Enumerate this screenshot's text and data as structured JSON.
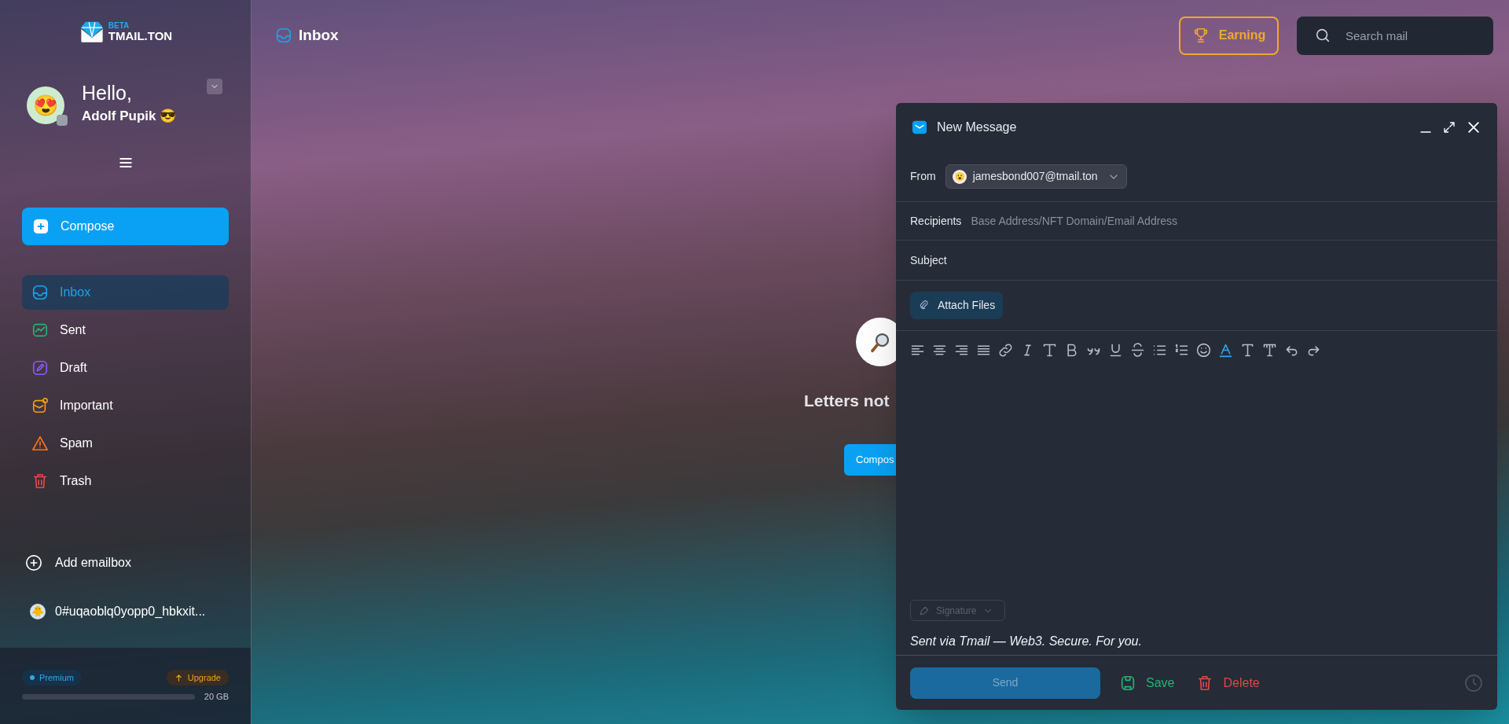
{
  "logo": {
    "badge": "BETA",
    "name": "TMAIL.TON"
  },
  "user": {
    "greeting": "Hello,",
    "name": "Adolf Pupik",
    "name_emoji": "😎",
    "avatar_emoji": "😍"
  },
  "compose_button": "Compose",
  "nav": [
    {
      "label": "Inbox",
      "kind": "inbox",
      "color": "#1aa3f0",
      "selected": true
    },
    {
      "label": "Sent",
      "kind": "sent",
      "color": "#22b573",
      "selected": false
    },
    {
      "label": "Draft",
      "kind": "draft",
      "color": "#8b5cf6",
      "selected": false
    },
    {
      "label": "Important",
      "kind": "important",
      "color": "#f59e0b",
      "selected": false
    },
    {
      "label": "Spam",
      "kind": "spam",
      "color": "#f97316",
      "selected": false
    },
    {
      "label": "Trash",
      "kind": "trash",
      "color": "#ef4444",
      "selected": false
    }
  ],
  "add_emailbox": "Add emailbox",
  "accounts": [
    {
      "emoji": "🐥",
      "address": "0#uqaoblq0yopp0_hbkxit..."
    }
  ],
  "plan": {
    "badge": "Premium",
    "upgrade": "Upgrade",
    "level": 0,
    "storage": "20 GB"
  },
  "header": {
    "title": "Inbox",
    "earning": "Earning",
    "search": {
      "placeholder": "Search mail"
    }
  },
  "empty_state": {
    "message": "Letters not",
    "button": "Compos"
  },
  "compose_window": {
    "title": "New Message",
    "from": {
      "label": "From",
      "emoji": "😮",
      "value": "jamesbond007@tmail.ton"
    },
    "recipients": {
      "label": "Recipients",
      "placeholder": "Base Address/NFT Domain/Email Address"
    },
    "subject": {
      "label": "Subject"
    },
    "attach": "Attach Files",
    "signature": "Signature",
    "signature_text": "Sent via Tmail — Web3. Secure. For you.",
    "send": "Send",
    "save": "Save",
    "delete": "Delete"
  }
}
